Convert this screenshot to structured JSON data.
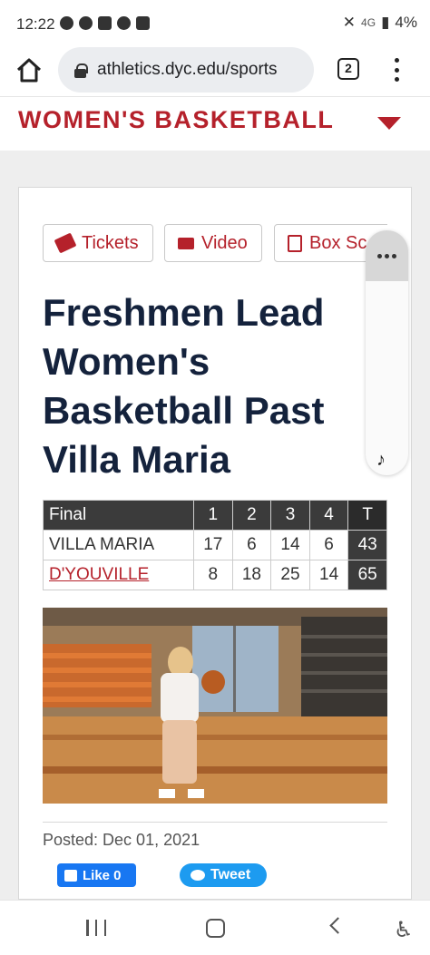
{
  "status_bar": {
    "time": "12:22",
    "network": "4G",
    "battery": "4%"
  },
  "browser": {
    "url": "athletics.dyc.edu/sports",
    "tab_count": "2"
  },
  "sport_header": {
    "title": "WOMEN'S BASKETBALL"
  },
  "actions": {
    "tickets_label": "Tickets",
    "video_label": "Video",
    "box_score_label": "Box Sc"
  },
  "article": {
    "headline": "Freshmen Lead Women's Basketball Past Villa Maria",
    "posted": "Posted: Dec 01, 2021"
  },
  "box_score": {
    "headers": [
      "Final",
      "1",
      "2",
      "3",
      "4",
      "T"
    ],
    "rows": [
      {
        "team": "VILLA MARIA",
        "q1": "17",
        "q2": "6",
        "q3": "14",
        "q4": "6",
        "total": "43"
      },
      {
        "team": "D'YOUVILLE",
        "q1": "8",
        "q2": "18",
        "q3": "25",
        "q4": "14",
        "total": "65"
      }
    ]
  },
  "social": {
    "like_label": "Like 0",
    "tweet_label": "Tweet"
  },
  "colors": {
    "brand_red": "#b5212b",
    "headline_navy": "#14223c",
    "facebook_blue": "#1877f2",
    "twitter_blue": "#1d9bf0"
  }
}
